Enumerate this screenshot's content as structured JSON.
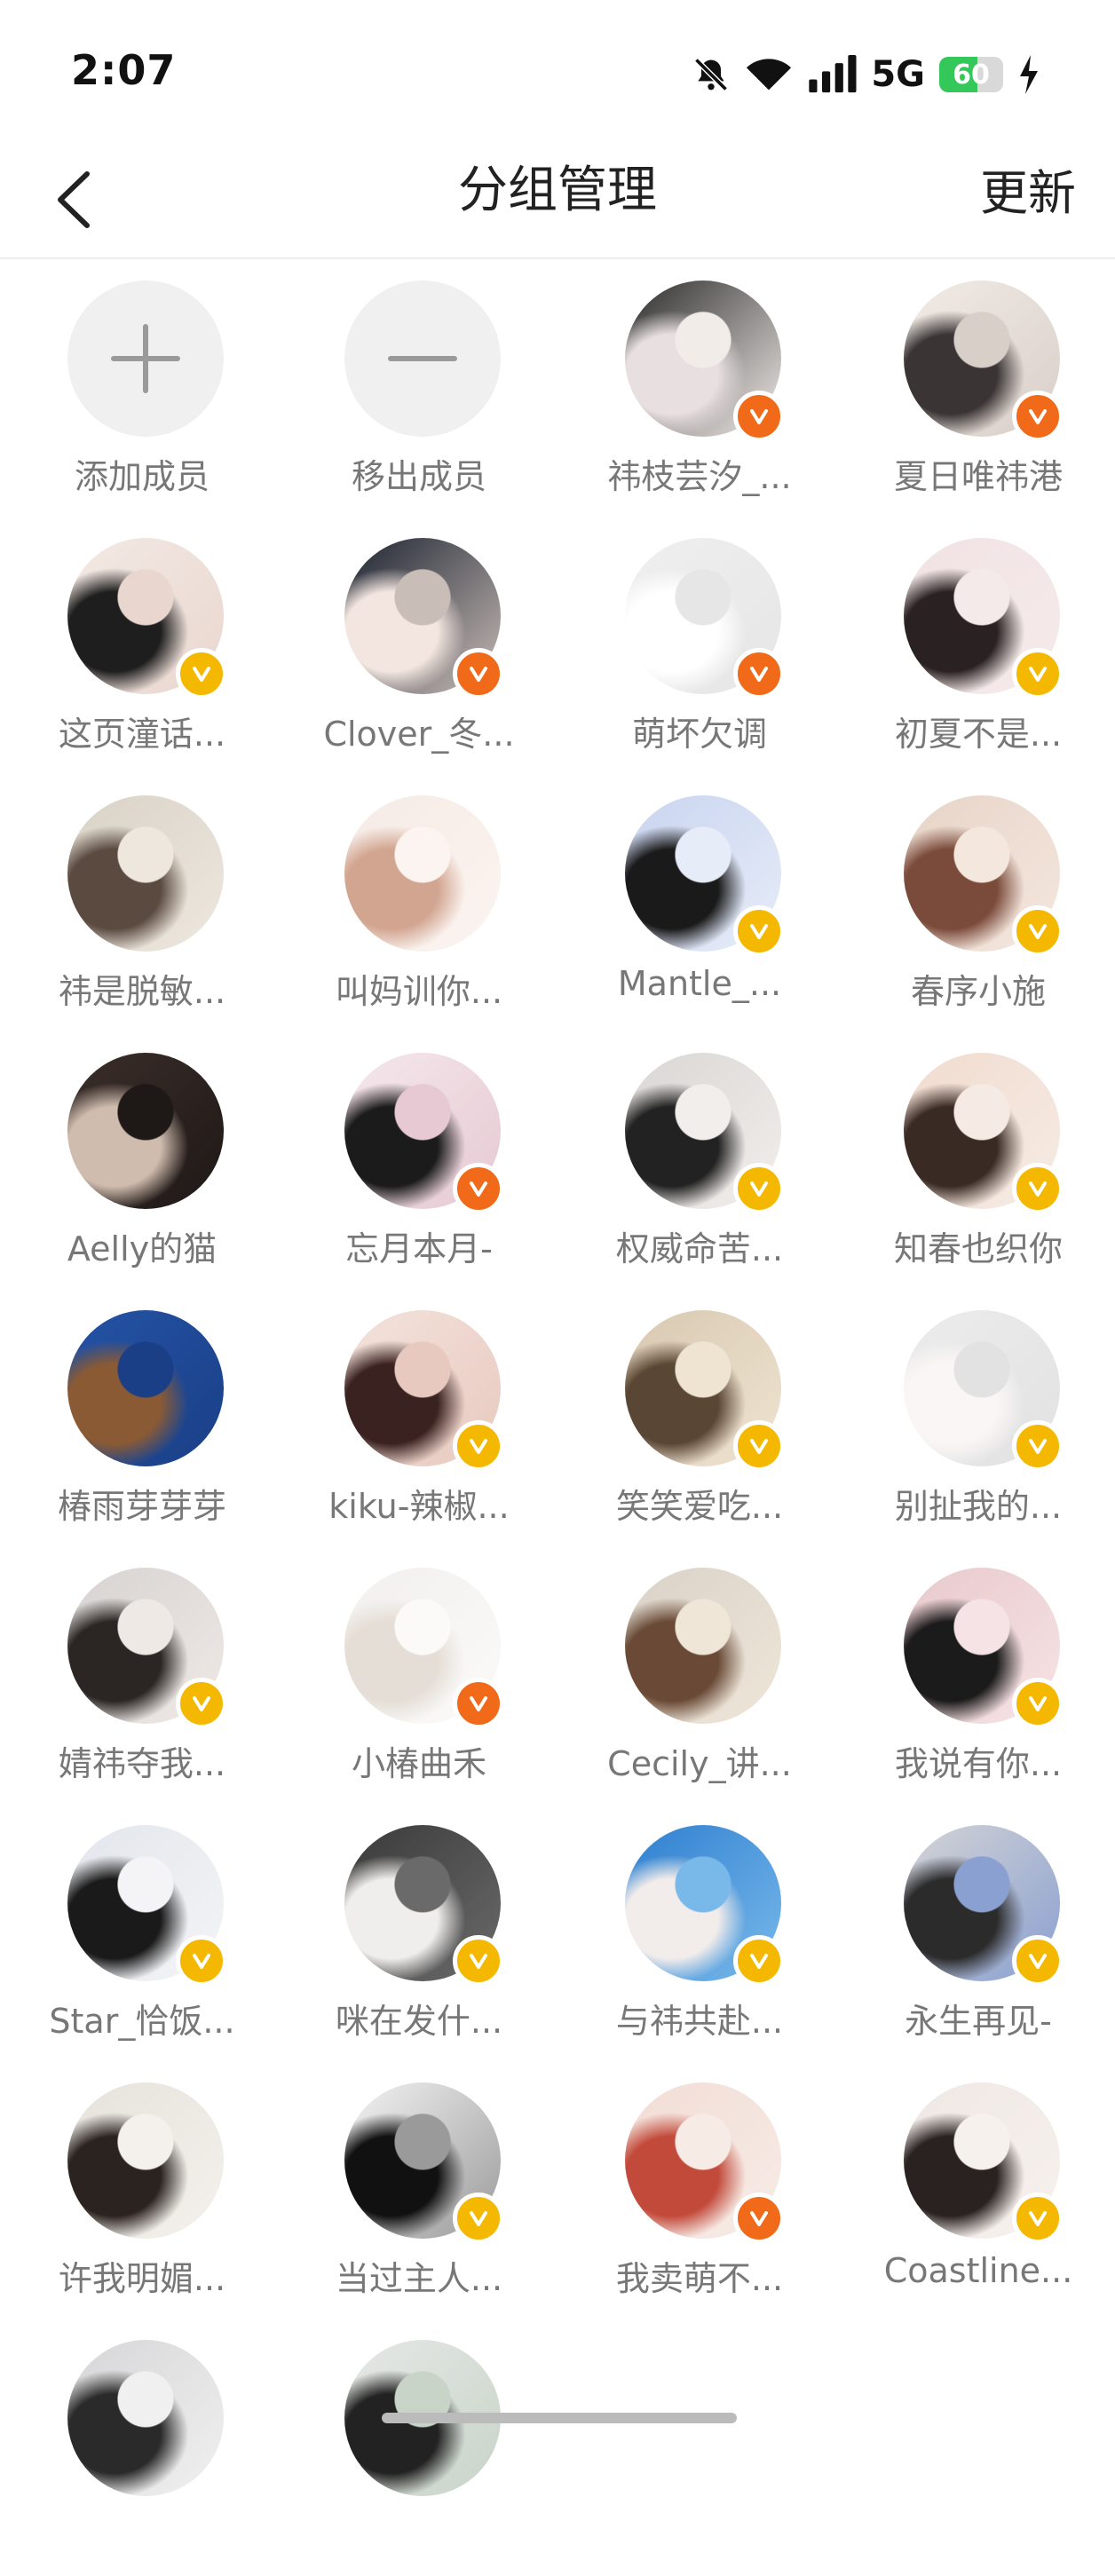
{
  "status_bar": {
    "time": "2:07",
    "network": "5G",
    "battery": "60",
    "battery_level": 0.6,
    "icons": [
      "bell-off-icon",
      "wifi-icon",
      "signal-icon",
      "charging-icon"
    ]
  },
  "nav": {
    "title": "分组管理",
    "action": "更新",
    "back_icon": "chevron-left-icon"
  },
  "actions": [
    {
      "label": "添加成员",
      "icon": "plus-icon"
    },
    {
      "label": "移出成员",
      "icon": "minus-icon"
    }
  ],
  "members": [
    {
      "name": "祎枝芸汐_...",
      "badge": "orange",
      "tone": [
        "#2b2b2b",
        "#e8dfe0",
        "#f2ece9"
      ]
    },
    {
      "name": "夏日唯祎港",
      "badge": "orange",
      "tone": [
        "#f1ebe6",
        "#3a3434",
        "#d9cfc9"
      ]
    },
    {
      "name": "这页潼话...",
      "badge": "gold",
      "tone": [
        "#f3e9e4",
        "#1e1e1e",
        "#e9d7cf"
      ]
    },
    {
      "name": "Clover_冬...",
      "badge": "orange",
      "tone": [
        "#1c2330",
        "#f3e6e0",
        "#c9bdb7"
      ]
    },
    {
      "name": "萌坏欠调",
      "badge": "orange",
      "tone": [
        "#efefef",
        "#ffffff",
        "#e6e6e6"
      ]
    },
    {
      "name": "初夏不是...",
      "badge": "gold",
      "tone": [
        "#f2e3e3",
        "#2a2222",
        "#f5eaea"
      ]
    },
    {
      "name": "祎是脱敏...",
      "badge": "none",
      "tone": [
        "#d8d2c7",
        "#5a4a40",
        "#eee7de"
      ]
    },
    {
      "name": "叫妈训你...",
      "badge": "none",
      "tone": [
        "#f6ebe6",
        "#d2a590",
        "#fbf4f0"
      ]
    },
    {
      "name": "Mantle_...",
      "badge": "gold",
      "tone": [
        "#c9d4ef",
        "#1a1a1a",
        "#e6ecf8"
      ]
    },
    {
      "name": "春序小施",
      "badge": "gold",
      "tone": [
        "#e8d4c8",
        "#7a4a3a",
        "#f4e7de"
      ]
    },
    {
      "name": "Aelly的猫",
      "badge": "none",
      "tone": [
        "#3b2e2a",
        "#cfbcae",
        "#1e1816"
      ]
    },
    {
      "name": "忘月本月-",
      "badge": "orange",
      "tone": [
        "#f5e8ec",
        "#1b1b1b",
        "#e6c9d2"
      ]
    },
    {
      "name": "权威命苦...",
      "badge": "gold",
      "tone": [
        "#d9d6d3",
        "#222222",
        "#f1eeeb"
      ]
    },
    {
      "name": "知春也织你",
      "badge": "gold",
      "tone": [
        "#f1dccf",
        "#3a2a24",
        "#f6ebe4"
      ]
    },
    {
      "name": "椿雨芽芽芽",
      "badge": "none",
      "tone": [
        "#2453a6",
        "#8a5a34",
        "#1a3f86"
      ]
    },
    {
      "name": "kiku-辣椒...",
      "badge": "gold",
      "tone": [
        "#f3e3dc",
        "#3a2220",
        "#e8c9bf"
      ]
    },
    {
      "name": "笑笑爱吃...",
      "badge": "gold",
      "tone": [
        "#d8c8b0",
        "#5a4634",
        "#efe4d2"
      ]
    },
    {
      "name": "别扯我的...",
      "badge": "gold",
      "tone": [
        "#ececec",
        "#fbf6f6",
        "#e2e2e2"
      ]
    },
    {
      "name": "婧祎夺我...",
      "badge": "gold",
      "tone": [
        "#d7d3d0",
        "#2b2524",
        "#efe9e6"
      ]
    },
    {
      "name": "小椿曲禾",
      "badge": "orange",
      "tone": [
        "#f2f0ee",
        "#e5ded6",
        "#fbfaf9"
      ]
    },
    {
      "name": "Cecily_讲...",
      "badge": "none",
      "tone": [
        "#d9d2c8",
        "#6a4a36",
        "#efe6d8"
      ]
    },
    {
      "name": "我说有你...",
      "badge": "gold",
      "tone": [
        "#e8c9cc",
        "#1c1b1b",
        "#f6e3e5"
      ]
    },
    {
      "name": "Star_恰饭...",
      "badge": "gold",
      "tone": [
        "#e2e6ec",
        "#1a1a1a",
        "#f4f4f6"
      ]
    },
    {
      "name": "咪在发什...",
      "badge": "gold",
      "tone": [
        "#3a3a3a",
        "#f0eeec",
        "#6a6a6a"
      ]
    },
    {
      "name": "与祎共赴...",
      "badge": "gold",
      "tone": [
        "#2e7fd0",
        "#f2ecea",
        "#79b9ea"
      ]
    },
    {
      "name": "永生再见-",
      "badge": "gold",
      "tone": [
        "#d4d4d6",
        "#2b2b2b",
        "#8aa0d0"
      ]
    },
    {
      "name": "许我明媚...",
      "badge": "none",
      "tone": [
        "#e6e2dc",
        "#2b2320",
        "#f4f1ec"
      ]
    },
    {
      "name": "当过主人...",
      "badge": "gold",
      "tone": [
        "#f4f4f4",
        "#111111",
        "#9a9a9a"
      ]
    },
    {
      "name": "我卖萌不...",
      "badge": "orange",
      "tone": [
        "#f2ddd6",
        "#c24a3a",
        "#f7ebe6"
      ]
    },
    {
      "name": "Coastline...",
      "badge": "gold",
      "tone": [
        "#efe8e4",
        "#2a2220",
        "#f7f1ee"
      ]
    },
    {
      "name": "",
      "badge": "none",
      "tone": [
        "#d6d6d8",
        "#2a2a2a",
        "#f0f0f0"
      ]
    },
    {
      "name": "",
      "badge": "none",
      "tone": [
        "#e6e8e6",
        "#222222",
        "#c8d4c8"
      ]
    }
  ],
  "colors": {
    "badge_gold": "#f5b800",
    "badge_orange": "#f06a1a",
    "label": "#777777",
    "action_bg": "#f0f0f0",
    "action_icon": "#9a9a9a"
  }
}
